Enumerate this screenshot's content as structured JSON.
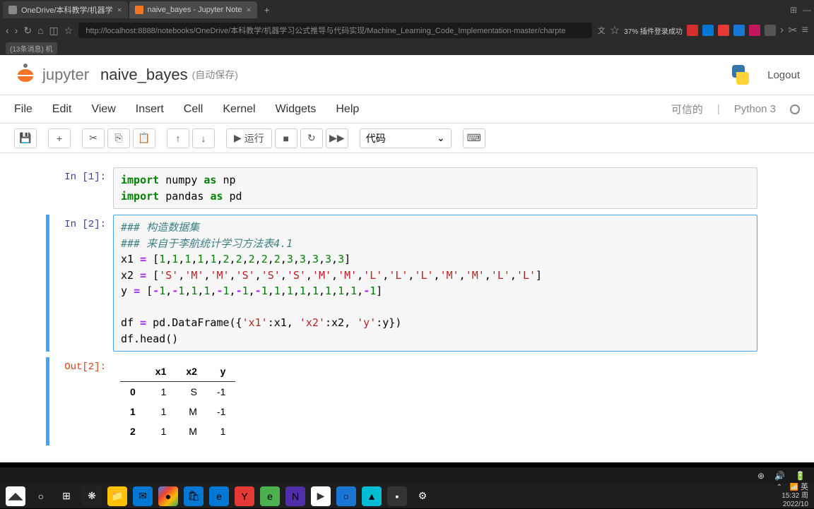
{
  "browser": {
    "tabs": [
      {
        "title": "OneDrive/本科教学/机器学",
        "active": false
      },
      {
        "title": "naive_bayes - Jupyter Note",
        "active": true
      }
    ],
    "url": "http://localhost:8888/notebooks/OneDrive/本科教学/机器学习公式推导与代码实现/Machine_Learning_Code_Implementation-master/charpte",
    "bookmarks": [
      "(13条消息) 机"
    ],
    "status_text": "37% 插件登录成功"
  },
  "jupyter": {
    "logo_text": "jupyter",
    "notebook_title": "naive_bayes",
    "autosave": "(自动保存)",
    "logout": "Logout",
    "menu": [
      "File",
      "Edit",
      "View",
      "Insert",
      "Cell",
      "Kernel",
      "Widgets",
      "Help"
    ],
    "trusted": "可信的",
    "kernel": "Python 3",
    "toolbar": {
      "run_label": "运行",
      "cell_type": "代码"
    }
  },
  "cells": [
    {
      "prompt": "In [1]:",
      "code_html": "<span class='kw'>import</span> numpy <span class='kw'>as</span> np\n<span class='kw'>import</span> pandas <span class='kw'>as</span> pd"
    },
    {
      "prompt": "In [2]:",
      "code_html": "<span class='cm'>### 构造数据集</span>\n<span class='cm'>### 来自于李航统计学习方法表4.1</span>\nx1 <span class='op'>=</span> [<span class='num'>1</span>,<span class='num'>1</span>,<span class='num'>1</span>,<span class='num'>1</span>,<span class='num'>1</span>,<span class='num'>2</span>,<span class='num'>2</span>,<span class='num'>2</span>,<span class='num'>2</span>,<span class='num'>2</span>,<span class='num'>3</span>,<span class='num'>3</span>,<span class='num'>3</span>,<span class='num'>3</span>,<span class='num'>3</span>]\nx2 <span class='op'>=</span> [<span class='str'>'S'</span>,<span class='str'>'M'</span>,<span class='str'>'M'</span>,<span class='str'>'S'</span>,<span class='str'>'S'</span>,<span class='str'>'S'</span>,<span class='str'>'M'</span>,<span class='str'>'M'</span>,<span class='str'>'L'</span>,<span class='str'>'L'</span>,<span class='str'>'L'</span>,<span class='str'>'M'</span>,<span class='str'>'M'</span>,<span class='str'>'L'</span>,<span class='str'>'L'</span>]\ny <span class='op'>=</span> [<span class='op'>-</span><span class='num'>1</span>,<span class='op'>-</span><span class='num'>1</span>,<span class='num'>1</span>,<span class='num'>1</span>,<span class='op'>-</span><span class='num'>1</span>,<span class='op'>-</span><span class='num'>1</span>,<span class='op'>-</span><span class='num'>1</span>,<span class='num'>1</span>,<span class='num'>1</span>,<span class='num'>1</span>,<span class='num'>1</span>,<span class='num'>1</span>,<span class='num'>1</span>,<span class='num'>1</span>,<span class='op'>-</span><span class='num'>1</span>]\n\ndf <span class='op'>=</span> pd.DataFrame({<span class='str'>'x1'</span>:x1, <span class='str'>'x2'</span>:x2, <span class='str'>'y'</span>:y})\ndf.head()"
    }
  ],
  "output": {
    "prompt": "Out[2]:",
    "columns": [
      "x1",
      "x2",
      "y"
    ],
    "rows": [
      {
        "idx": "0",
        "vals": [
          "1",
          "S",
          "-1"
        ]
      },
      {
        "idx": "1",
        "vals": [
          "1",
          "M",
          "-1"
        ]
      },
      {
        "idx": "2",
        "vals": [
          "1",
          "M",
          "1"
        ]
      }
    ]
  },
  "taskbar": {
    "lang": "英",
    "time": "15:32 周",
    "date": "2022/10"
  }
}
